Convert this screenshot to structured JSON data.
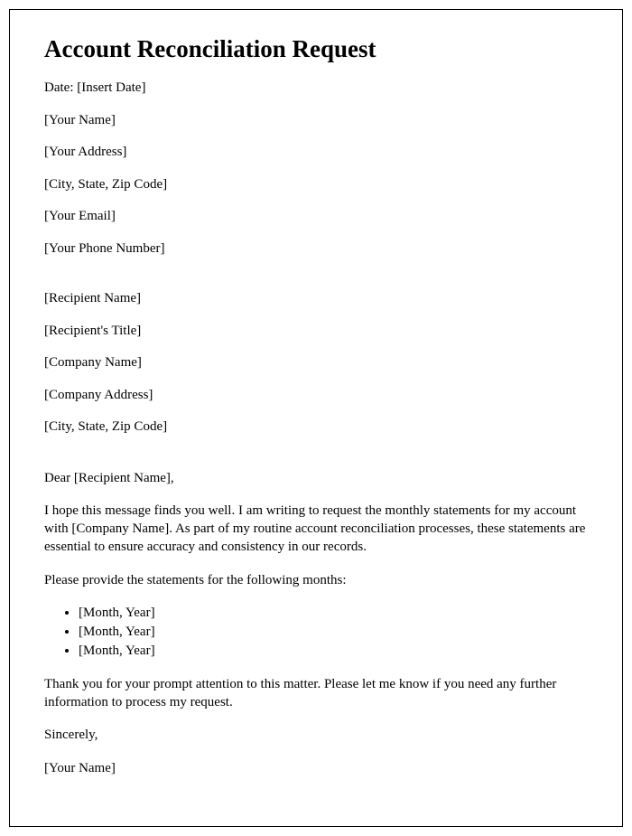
{
  "title": "Account Reconciliation Request",
  "sender": {
    "date": "Date: [Insert Date]",
    "name": "[Your Name]",
    "address": "[Your Address]",
    "city_state_zip": "[City, State, Zip Code]",
    "email": "[Your Email]",
    "phone": "[Your Phone Number]"
  },
  "recipient": {
    "name": "[Recipient Name]",
    "title": "[Recipient's Title]",
    "company": "[Company Name]",
    "address": "[Company Address]",
    "city_state_zip": "[City, State, Zip Code]"
  },
  "salutation": "Dear [Recipient Name],",
  "body": {
    "intro": "I hope this message finds you well. I am writing to request the monthly statements for my account with [Company Name]. As part of my routine account reconciliation processes, these statements are essential to ensure accuracy and consistency in our records.",
    "request": "Please provide the statements for the following months:",
    "months": [
      "[Month, Year]",
      "[Month, Year]",
      "[Month, Year]"
    ],
    "closing": "Thank you for your prompt attention to this matter. Please let me know if you need any further information to process my request."
  },
  "signoff": "Sincerely,",
  "signature": "[Your Name]"
}
